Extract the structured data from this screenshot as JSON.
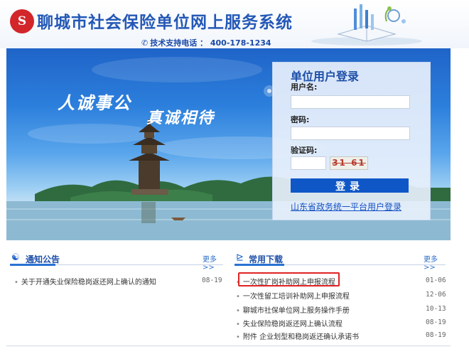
{
  "header": {
    "title": "聊城市社会保险单位网上服务系统",
    "hotline": "技术支持电话 ： 400-178-1234"
  },
  "banner": {
    "slogan1": "人诚事公",
    "slogan2": "真诚相待"
  },
  "login": {
    "title": "单位用户登录",
    "username_label": "用户名:",
    "password_label": "密码:",
    "captcha_label": "验证码:",
    "captcha_text": "31 61",
    "button": "登录",
    "unified_link": "山东省政务统一平台用户登录"
  },
  "notices": {
    "title": "通知公告",
    "more": "更多>>",
    "items": [
      {
        "text": "关于开通失业保险稳岗返还网上确认的通知",
        "date": "08-19"
      }
    ]
  },
  "downloads": {
    "title": "常用下载",
    "more": "更多>>",
    "items": [
      {
        "text": "一次性扩岗补助网上申报流程",
        "date": "01-06"
      },
      {
        "text": "一次性留工培训补助网上申报流程",
        "date": "12-06"
      },
      {
        "text": "聊城市社保单位网上服务操作手册",
        "date": "10-13"
      },
      {
        "text": "失业保险稳岗返还网上确认流程",
        "date": "08-19"
      },
      {
        "text": "附件 企业划型和稳岗返还确认承诺书",
        "date": "08-19"
      }
    ]
  },
  "colors": {
    "brand_blue": "#2458b6",
    "logo_red": "#d2262a",
    "login_button": "#0f57c7",
    "highlight_red": "#e02222"
  }
}
